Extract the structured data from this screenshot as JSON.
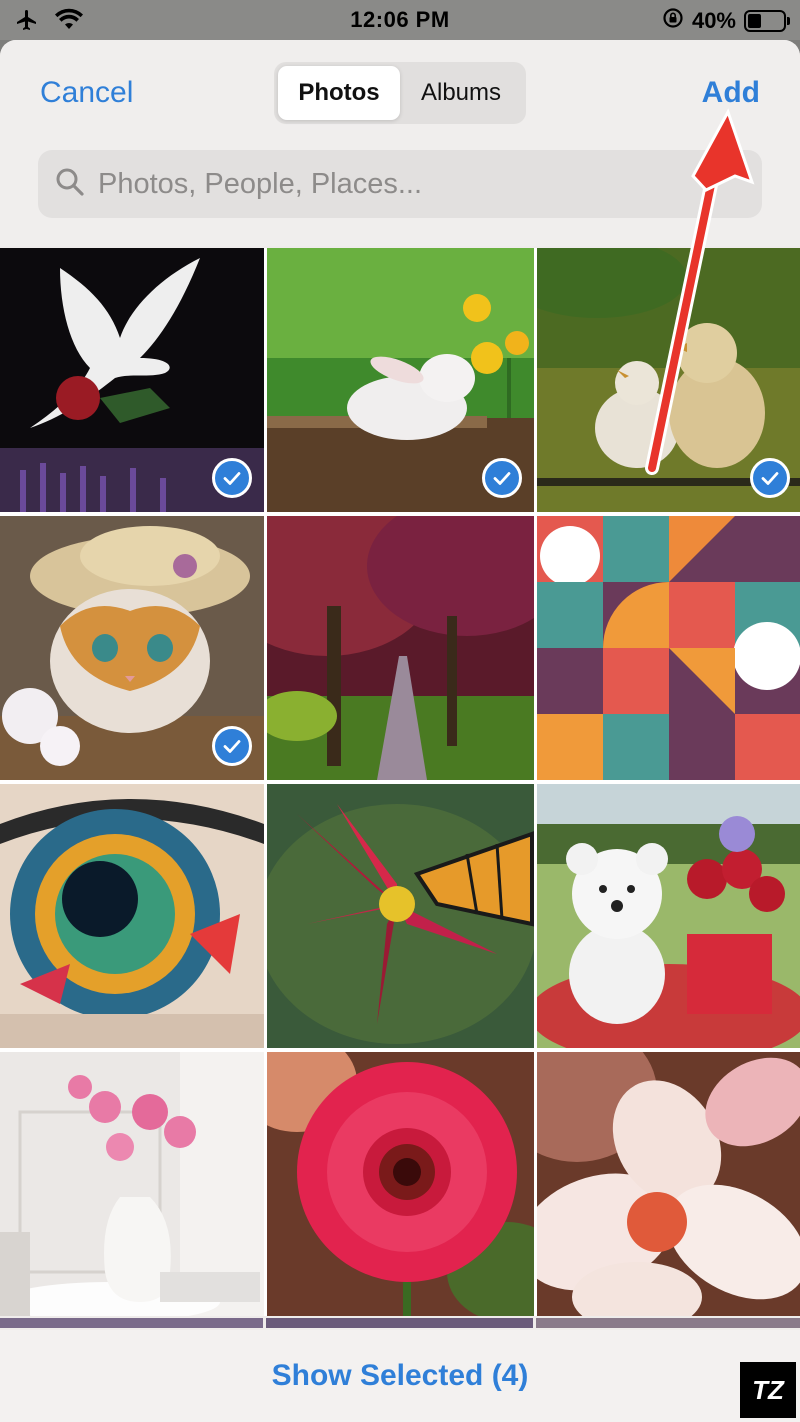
{
  "status_bar": {
    "time": "12:06 PM",
    "battery_label": "40%",
    "icons": [
      "airplane-icon",
      "wifi-icon",
      "rotation-lock-icon",
      "battery-icon"
    ],
    "battery_level": 0.4
  },
  "header": {
    "cancel_label": "Cancel",
    "add_label": "Add",
    "tabs": [
      {
        "label": "Photos",
        "active": true
      },
      {
        "label": "Albums",
        "active": false
      }
    ],
    "search_placeholder": "Photos, People, Places..."
  },
  "photos": [
    {
      "name": "white-dove-photo",
      "selected": true
    },
    {
      "name": "white-bunny-photo",
      "selected": true
    },
    {
      "name": "chicks-photo",
      "selected": true
    },
    {
      "name": "kitten-hat-photo",
      "selected": true
    },
    {
      "name": "tree-path-photo",
      "selected": false
    },
    {
      "name": "geometric-pattern-photo",
      "selected": false
    },
    {
      "name": "painted-eye-photo",
      "selected": false
    },
    {
      "name": "butterfly-flower-photo",
      "selected": false
    },
    {
      "name": "teddy-bear-photo",
      "selected": false
    },
    {
      "name": "pink-flowers-vase-photo",
      "selected": false
    },
    {
      "name": "gerbera-daisy-photo",
      "selected": false
    },
    {
      "name": "plumeria-photo",
      "selected": false
    }
  ],
  "footer": {
    "show_selected_label": "Show Selected (4)"
  },
  "watermark": "TZ",
  "colors": {
    "accent": "#2f7fd8",
    "annotation_arrow": "#e8342b"
  }
}
